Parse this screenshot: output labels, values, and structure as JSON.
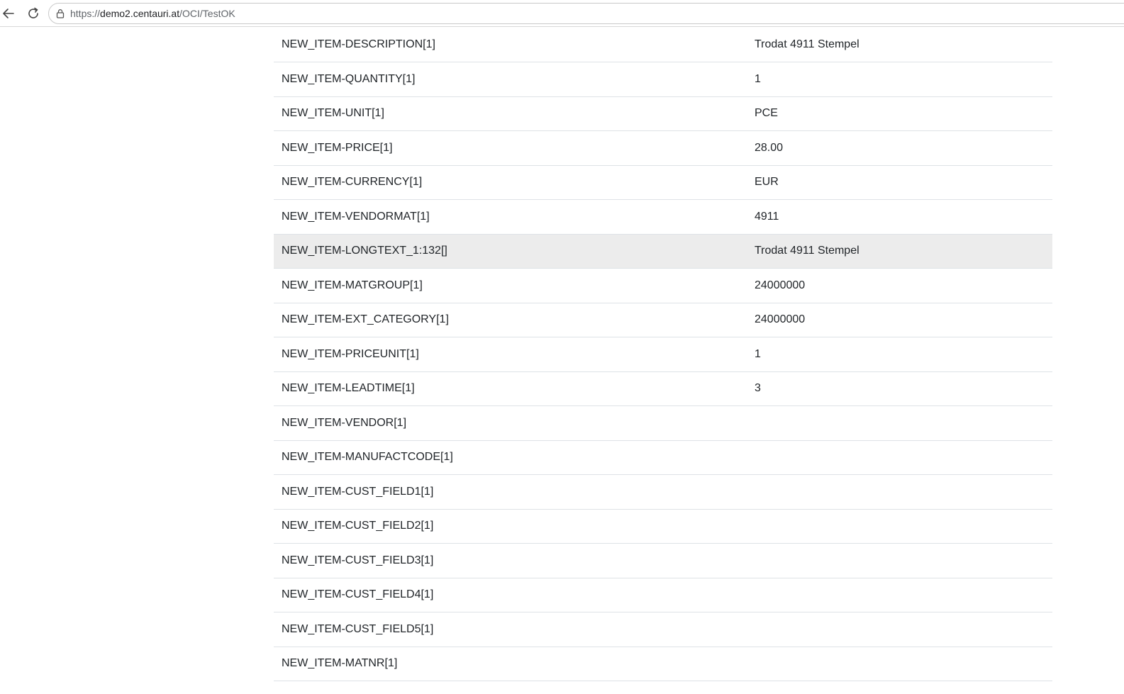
{
  "browser": {
    "url_scheme": "https://",
    "url_host": "demo2.centauri.at",
    "url_path": "/OCI/TestOK",
    "icons": {
      "back": "arrow-left-icon",
      "reload": "reload-icon",
      "lock": "lock-icon"
    }
  },
  "table": {
    "highlighted_row_index": 6,
    "rows": [
      {
        "key": "NEW_ITEM-DESCRIPTION[1]",
        "value": "Trodat 4911 Stempel"
      },
      {
        "key": "NEW_ITEM-QUANTITY[1]",
        "value": "1"
      },
      {
        "key": "NEW_ITEM-UNIT[1]",
        "value": "PCE"
      },
      {
        "key": "NEW_ITEM-PRICE[1]",
        "value": "28.00"
      },
      {
        "key": "NEW_ITEM-CURRENCY[1]",
        "value": "EUR"
      },
      {
        "key": "NEW_ITEM-VENDORMAT[1]",
        "value": "4911"
      },
      {
        "key": "NEW_ITEM-LONGTEXT_1:132[]",
        "value": "Trodat 4911 Stempel"
      },
      {
        "key": "NEW_ITEM-MATGROUP[1]",
        "value": "24000000"
      },
      {
        "key": "NEW_ITEM-EXT_CATEGORY[1]",
        "value": "24000000"
      },
      {
        "key": "NEW_ITEM-PRICEUNIT[1]",
        "value": "1"
      },
      {
        "key": "NEW_ITEM-LEADTIME[1]",
        "value": "3"
      },
      {
        "key": "NEW_ITEM-VENDOR[1]",
        "value": ""
      },
      {
        "key": "NEW_ITEM-MANUFACTCODE[1]",
        "value": ""
      },
      {
        "key": "NEW_ITEM-CUST_FIELD1[1]",
        "value": ""
      },
      {
        "key": "NEW_ITEM-CUST_FIELD2[1]",
        "value": ""
      },
      {
        "key": "NEW_ITEM-CUST_FIELD3[1]",
        "value": ""
      },
      {
        "key": "NEW_ITEM-CUST_FIELD4[1]",
        "value": ""
      },
      {
        "key": "NEW_ITEM-CUST_FIELD5[1]",
        "value": ""
      },
      {
        "key": "NEW_ITEM-MATNR[1]",
        "value": ""
      }
    ]
  }
}
